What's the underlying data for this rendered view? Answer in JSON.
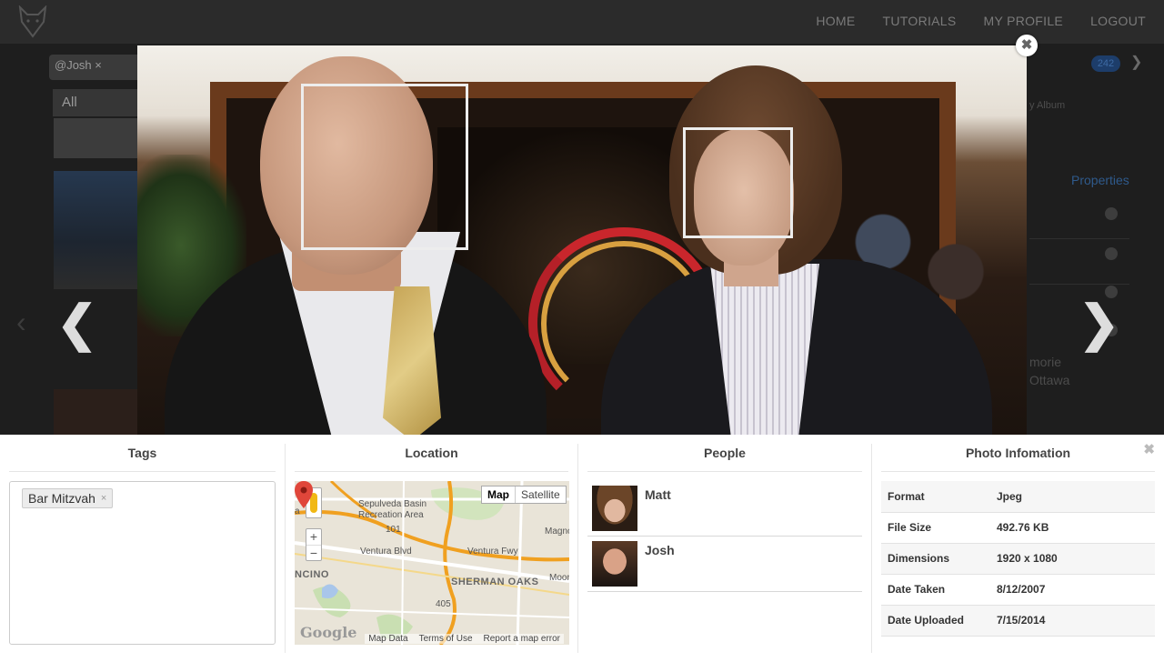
{
  "nav": {
    "home": "HOME",
    "tutorials": "TUTORIALS",
    "profile": "MY PROFILE",
    "logout": "LOGOUT"
  },
  "background": {
    "search_chip": "@Josh ×",
    "filter_all": "All",
    "count_badge": "242",
    "album_label": "y Album",
    "properties_label": "Properties",
    "note_line1": "morie",
    "note_line2": "Ottawa"
  },
  "lightbox": {
    "prev_icon": "chevron-left",
    "next_icon": "chevron-right",
    "close_glyph": "✖",
    "prev_glyph": "❮",
    "next_glyph": "❯"
  },
  "panel": {
    "close_glyph": "✖",
    "tags": {
      "title": "Tags",
      "items": [
        {
          "label": "Bar Mitzvah",
          "remove": "×"
        }
      ]
    },
    "location": {
      "title": "Location",
      "map_type": {
        "map": "Map",
        "satellite": "Satellite"
      },
      "zoom": {
        "in": "+",
        "out": "−"
      },
      "labels": {
        "basin": "Sepulveda Basin",
        "recreation": "Recreation Area",
        "fwy101": "101",
        "ventura_fwy": "Ventura Fwy",
        "ventura_blvd": "Ventura Blvd",
        "encino": "NCINO",
        "sherman_oaks": "SHERMAN OAKS",
        "magnolia": "Magno",
        "moor": "Moor",
        "fwy405": "405",
        "edge_a": "a"
      },
      "brand": "Google",
      "footer": [
        "Map Data",
        "Terms of Use",
        "Report a map error"
      ]
    },
    "people": {
      "title": "People",
      "items": [
        {
          "name": "Matt"
        },
        {
          "name": "Josh"
        }
      ]
    },
    "info": {
      "title": "Photo Infomation",
      "rows": [
        {
          "label": "Format",
          "value": "Jpeg"
        },
        {
          "label": "File Size",
          "value": "492.76 KB"
        },
        {
          "label": "Dimensions",
          "value": "1920 x 1080"
        },
        {
          "label": "Date Taken",
          "value": "8/12/2007"
        },
        {
          "label": "Date Uploaded",
          "value": "7/15/2014"
        }
      ]
    }
  }
}
